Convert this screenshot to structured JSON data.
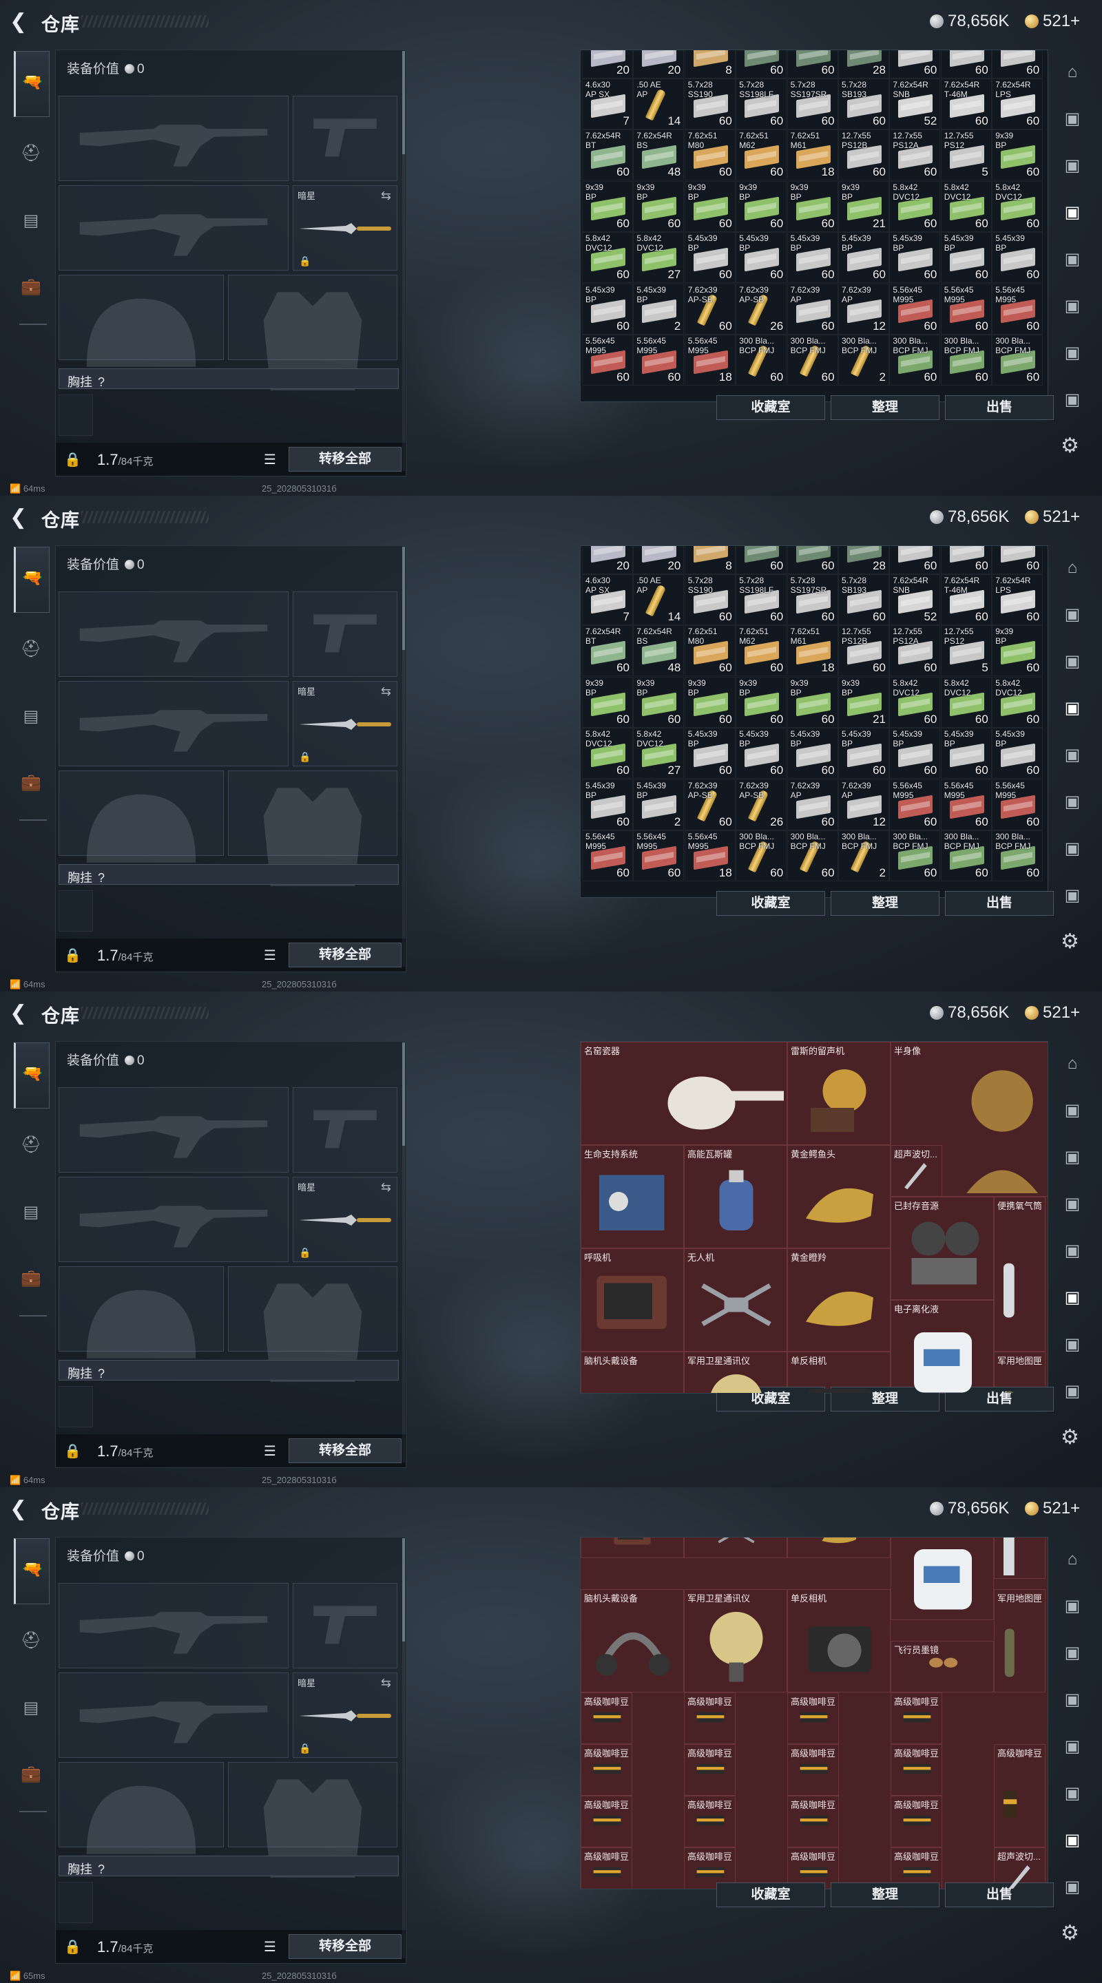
{
  "header": {
    "title": "仓库",
    "silver": "78,656K",
    "gold": "521+"
  },
  "equipment": {
    "value_label": "装备价值",
    "value": "0",
    "secondary_label": "暗星",
    "chest_label": "胸挂",
    "chest_help": "?",
    "weight": "1.7",
    "weight_max": "/84千克",
    "transfer_label": "转移全部"
  },
  "status": {
    "ping_1": "64ms",
    "ping_4": "65ms",
    "build": "25_20280531031б"
  },
  "actions": {
    "collection": "收藏室",
    "sort": "整理",
    "sell": "出售"
  },
  "icons": [
    "back-arrow-icon",
    "pistol-icon",
    "helmet-icon",
    "armor-icon",
    "backpack-icon",
    "lock-icon",
    "list-icon",
    "settings-icon",
    "silver-coin-icon",
    "gold-coin-icon"
  ],
  "colors": {
    "stash_bg": "#121820",
    "valuables_bg": "#4a2125",
    "gold_coin": "#d9a441",
    "silver_coin": "#b8bec4"
  },
  "ammo_view_1": {
    "rows": [
      [
        {
          "n": "",
          "q": "20",
          "c": "#b8b9c6"
        },
        {
          "n": "",
          "q": "20",
          "c": "#b8b9c6"
        },
        {
          "n": "",
          "q": "8",
          "c": "#cfa86a"
        },
        {
          "n": "",
          "q": "60",
          "c": "#6e8a73"
        },
        {
          "n": "",
          "q": "60",
          "c": "#6e8a73"
        },
        {
          "n": "",
          "q": "28",
          "c": "#6e8a73"
        },
        {
          "n": "",
          "q": "60",
          "c": "#c8c8c8"
        },
        {
          "n": "",
          "q": "60",
          "c": "#c8c8c8"
        },
        {
          "n": "",
          "q": "60",
          "c": "#c8c8c8"
        }
      ],
      [
        {
          "n": "4.6x30\nAP SX",
          "q": "7",
          "c": "#cfcfcf"
        },
        {
          "n": ".50 AE\nAP",
          "q": "14",
          "c": "shell"
        },
        {
          "n": "5.7x28\nSS190",
          "q": "60",
          "c": "#c8c8c8"
        },
        {
          "n": "5.7x28\nSS198LF",
          "q": "60",
          "c": "#c8c8c8"
        },
        {
          "n": "5.7x28\nSS197SR",
          "q": "60",
          "c": "#c8c8c8"
        },
        {
          "n": "5.7x28\nSB193",
          "q": "60",
          "c": "#c8c8c8"
        },
        {
          "n": "7.62x54R\nSNB",
          "q": "52",
          "c": "#d6d6d6"
        },
        {
          "n": "7.62x54R\nT-46M",
          "q": "60",
          "c": "#d6d6d6"
        },
        {
          "n": "7.62x54R\nLPS",
          "q": "60",
          "c": "#d6d6d6"
        }
      ],
      [
        {
          "n": "7.62x54R\nBT",
          "q": "60",
          "c": "#8fb58e"
        },
        {
          "n": "7.62x54R\nBS",
          "q": "48",
          "c": "#8fb58e"
        },
        {
          "n": "7.62x51\nM80",
          "q": "60",
          "c": "#d9a65a"
        },
        {
          "n": "7.62x51\nM62",
          "q": "60",
          "c": "#d9a65a"
        },
        {
          "n": "7.62x51\nM61",
          "q": "18",
          "c": "#d9a65a"
        },
        {
          "n": "12.7x55\nPS12B",
          "q": "60",
          "c": "#c8c8c8"
        },
        {
          "n": "12.7x55\nPS12A",
          "q": "60",
          "c": "#c8c8c8"
        },
        {
          "n": "12.7x55\nPS12",
          "q": "5",
          "c": "#c8c8c8"
        },
        {
          "n": "9x39\nBP",
          "q": "60",
          "c": "#8ec16a"
        }
      ],
      [
        {
          "n": "9x39\nBP",
          "q": "60",
          "c": "#8ec16a"
        },
        {
          "n": "9x39\nBP",
          "q": "60",
          "c": "#8ec16a"
        },
        {
          "n": "9x39\nBP",
          "q": "60",
          "c": "#8ec16a"
        },
        {
          "n": "9x39\nBP",
          "q": "60",
          "c": "#8ec16a"
        },
        {
          "n": "9x39\nBP",
          "q": "60",
          "c": "#8ec16a"
        },
        {
          "n": "9x39\nBP",
          "q": "21",
          "c": "#8ec16a"
        },
        {
          "n": "5.8x42\nDVC12",
          "q": "60",
          "c": "#8ec16a"
        },
        {
          "n": "5.8x42\nDVC12",
          "q": "60",
          "c": "#8ec16a"
        },
        {
          "n": "5.8x42\nDVC12",
          "q": "60",
          "c": "#8ec16a"
        }
      ],
      [
        {
          "n": "5.8x42\nDVC12",
          "q": "60",
          "c": "#8ec16a"
        },
        {
          "n": "5.8x42\nDVC12",
          "q": "27",
          "c": "#8ec16a"
        },
        {
          "n": "5.45x39\nBP",
          "q": "60",
          "c": "#c8c8c8"
        },
        {
          "n": "5.45x39\nBP",
          "q": "60",
          "c": "#c8c8c8"
        },
        {
          "n": "5.45x39\nBP",
          "q": "60",
          "c": "#c8c8c8"
        },
        {
          "n": "5.45x39\nBP",
          "q": "60",
          "c": "#c8c8c8"
        },
        {
          "n": "5.45x39\nBP",
          "q": "60",
          "c": "#c8c8c8"
        },
        {
          "n": "5.45x39\nBP",
          "q": "60",
          "c": "#c8c8c8"
        },
        {
          "n": "5.45x39\nBP",
          "q": "60",
          "c": "#c8c8c8"
        }
      ],
      [
        {
          "n": "5.45x39\nBP",
          "q": "60",
          "c": "#c8c8c8"
        },
        {
          "n": "5.45x39\nBP",
          "q": "2",
          "c": "#c8c8c8"
        },
        {
          "n": "7.62x39\nAP-SB",
          "q": "60",
          "c": "shell"
        },
        {
          "n": "7.62x39\nAP-SB",
          "q": "26",
          "c": "shell"
        },
        {
          "n": "7.62x39\nAP",
          "q": "60",
          "c": "#c8c8c8"
        },
        {
          "n": "7.62x39\nAP",
          "q": "12",
          "c": "#c8c8c8"
        },
        {
          "n": "5.56x45\nM995",
          "q": "60",
          "c": "#c05b55"
        },
        {
          "n": "5.56x45\nM995",
          "q": "60",
          "c": "#c05b55"
        },
        {
          "n": "5.56x45\nM995",
          "q": "60",
          "c": "#c05b55"
        }
      ],
      [
        {
          "n": "5.56x45\nM995",
          "q": "60",
          "c": "#c05b55"
        },
        {
          "n": "5.56x45\nM995",
          "q": "60",
          "c": "#c05b55"
        },
        {
          "n": "5.56x45\nM995",
          "q": "18",
          "c": "#c05b55"
        },
        {
          "n": "300 Bla...\nBCP FMJ",
          "q": "60",
          "c": "shell"
        },
        {
          "n": "300 Bla...\nBCP FMJ",
          "q": "60",
          "c": "shell"
        },
        {
          "n": "300 Bla...\nBCP FMJ",
          "q": "2",
          "c": "shell"
        },
        {
          "n": "300 Bla...\nBCP FMJ",
          "q": "60",
          "c": "#7ca86e"
        },
        {
          "n": "300 Bla...\nBCP FMJ",
          "q": "60",
          "c": "#7ca86e"
        },
        {
          "n": "300 Bla...\nBCP FMJ",
          "q": "60",
          "c": "#7ca86e"
        }
      ]
    ]
  },
  "ammo_view_2": {
    "rows": [
      [
        {
          "n": "",
          "q": "20",
          "c": "#b8b9c6"
        },
        {
          "n": "",
          "q": "20",
          "c": "#b8b9c6"
        },
        {
          "n": "",
          "q": "8",
          "c": "#cfa86a"
        },
        {
          "n": "",
          "q": "60",
          "c": "#6e8a73"
        },
        {
          "n": "",
          "q": "60",
          "c": "#6e8a73"
        },
        {
          "n": "",
          "q": "28",
          "c": "#6e8a73"
        },
        {
          "n": "",
          "q": "60",
          "c": "#c8c8c8"
        },
        {
          "n": "",
          "q": "60",
          "c": "#c8c8c8"
        },
        {
          "n": "",
          "q": "60",
          "c": "#c8c8c8"
        }
      ],
      [
        {
          "n": "4.6x30\nAP SX",
          "q": "7",
          "c": "#cfcfcf"
        },
        {
          "n": ".50 AE\nAP",
          "q": "14",
          "c": "shell"
        },
        {
          "n": "5.7x28\nSS190",
          "q": "60",
          "c": "#c8c8c8"
        },
        {
          "n": "5.7x28\nSS198LF",
          "q": "60",
          "c": "#c8c8c8"
        },
        {
          "n": "5.7x28\nSS197SR",
          "q": "60",
          "c": "#c8c8c8"
        },
        {
          "n": "5.7x28\nSB193",
          "q": "60",
          "c": "#c8c8c8"
        },
        {
          "n": "7.62x54R\nSNB",
          "q": "52",
          "c": "#d6d6d6"
        },
        {
          "n": "7.62x54R\nT-46M",
          "q": "60",
          "c": "#d6d6d6"
        },
        {
          "n": "7.62x54R\nLPS",
          "q": "60",
          "c": "#d6d6d6"
        }
      ],
      [
        {
          "n": "7.62x54R\nBT",
          "q": "60",
          "c": "#8fb58e"
        },
        {
          "n": "7.62x54R\nBS",
          "q": "48",
          "c": "#8fb58e"
        },
        {
          "n": "7.62x51\nM80",
          "q": "60",
          "c": "#d9a65a"
        },
        {
          "n": "7.62x51\nM62",
          "q": "60",
          "c": "#d9a65a"
        },
        {
          "n": "7.62x51\nM61",
          "q": "18",
          "c": "#d9a65a"
        },
        {
          "n": "12.7x55\nPS12B",
          "q": "60",
          "c": "#c8c8c8"
        },
        {
          "n": "12.7x55\nPS12A",
          "q": "60",
          "c": "#c8c8c8"
        },
        {
          "n": "12.7x55\nPS12",
          "q": "5",
          "c": "#c8c8c8"
        },
        {
          "n": "9x39\nBP",
          "q": "60",
          "c": "#8ec16a"
        }
      ],
      [
        {
          "n": "9x39\nBP",
          "q": "60",
          "c": "#8ec16a"
        },
        {
          "n": "9x39\nBP",
          "q": "60",
          "c": "#8ec16a"
        },
        {
          "n": "9x39\nBP",
          "q": "60",
          "c": "#8ec16a"
        },
        {
          "n": "9x39\nBP",
          "q": "60",
          "c": "#8ec16a"
        },
        {
          "n": "9x39\nBP",
          "q": "60",
          "c": "#8ec16a"
        },
        {
          "n": "9x39\nBP",
          "q": "21",
          "c": "#8ec16a"
        },
        {
          "n": "5.8x42\nDVC12",
          "q": "60",
          "c": "#8ec16a"
        },
        {
          "n": "5.8x42\nDVC12",
          "q": "60",
          "c": "#8ec16a"
        },
        {
          "n": "5.8x42\nDVC12",
          "q": "60",
          "c": "#8ec16a"
        }
      ],
      [
        {
          "n": "5.8x42\nDVC12",
          "q": "60",
          "c": "#8ec16a"
        },
        {
          "n": "5.8x42\nDVC12",
          "q": "27",
          "c": "#8ec16a"
        },
        {
          "n": "5.45x39\nBP",
          "q": "60",
          "c": "#c8c8c8"
        },
        {
          "n": "5.45x39\nBP",
          "q": "60",
          "c": "#c8c8c8"
        },
        {
          "n": "5.45x39\nBP",
          "q": "60",
          "c": "#c8c8c8"
        },
        {
          "n": "5.45x39\nBP",
          "q": "60",
          "c": "#c8c8c8"
        },
        {
          "n": "5.45x39\nBP",
          "q": "60",
          "c": "#c8c8c8"
        },
        {
          "n": "5.45x39\nBP",
          "q": "60",
          "c": "#c8c8c8"
        },
        {
          "n": "5.45x39\nBP",
          "q": "60",
          "c": "#c8c8c8"
        }
      ],
      [
        {
          "n": "5.45x39\nBP",
          "q": "60",
          "c": "#c8c8c8"
        },
        {
          "n": "5.45x39\nBP",
          "q": "2",
          "c": "#c8c8c8"
        },
        {
          "n": "7.62x39\nAP-SB",
          "q": "60",
          "c": "shell"
        },
        {
          "n": "7.62x39\nAP-SB",
          "q": "26",
          "c": "shell"
        },
        {
          "n": "7.62x39\nAP",
          "q": "60",
          "c": "#c8c8c8"
        },
        {
          "n": "7.62x39\nAP",
          "q": "12",
          "c": "#c8c8c8"
        },
        {
          "n": "5.56x45\nM995",
          "q": "60",
          "c": "#c05b55"
        },
        {
          "n": "5.56x45\nM995",
          "q": "60",
          "c": "#c05b55"
        },
        {
          "n": "5.56x45\nM995",
          "q": "60",
          "c": "#c05b55"
        }
      ],
      [
        {
          "n": "5.56x45\nM995",
          "q": "60",
          "c": "#c05b55"
        },
        {
          "n": "5.56x45\nM995",
          "q": "60",
          "c": "#c05b55"
        },
        {
          "n": "5.56x45\nM995",
          "q": "18",
          "c": "#c05b55"
        },
        {
          "n": "300 Bla...\nBCP FMJ",
          "q": "60",
          "c": "shell"
        },
        {
          "n": "300 Bla...\nBCP FMJ",
          "q": "60",
          "c": "shell"
        },
        {
          "n": "300 Bla...\nBCP FMJ",
          "q": "2",
          "c": "shell"
        },
        {
          "n": "300 Bla...\nBCP FMJ",
          "q": "60",
          "c": "#7ca86e"
        },
        {
          "n": "300 Bla...\nBCP FMJ",
          "q": "60",
          "c": "#7ca86e"
        },
        {
          "n": "300 Bla...\nBCP FMJ",
          "q": "60",
          "c": "#7ca86e"
        }
      ]
    ]
  },
  "valuables_view_3": {
    "items": [
      {
        "n": "名窑瓷器",
        "shape": "vase",
        "col": 0,
        "row": 0,
        "w": 2,
        "h": 1
      },
      {
        "n": "雷斯的留声机",
        "shape": "gramophone",
        "col": 2,
        "row": 0,
        "w": 1,
        "h": 1
      },
      {
        "n": "半身像",
        "shape": "bust",
        "col": 3,
        "row": 0,
        "w": 2,
        "h": 1.5
      },
      {
        "n": "生命支持系统",
        "shape": "machine",
        "col": 0,
        "row": 1,
        "w": 1,
        "h": 1
      },
      {
        "n": "高能瓦斯罐",
        "shape": "canister",
        "col": 1,
        "row": 1,
        "w": 1,
        "h": 1
      },
      {
        "n": "黄金鳄鱼头",
        "shape": "goldhead",
        "col": 2,
        "row": 1,
        "w": 1,
        "h": 1
      },
      {
        "n": "超声波切...",
        "shape": "knife",
        "col": 3,
        "row": 1,
        "w": 0.5,
        "h": 0.5
      },
      {
        "n": "已封存音源",
        "shape": "projector",
        "col": 3,
        "row": 1.5,
        "w": 1,
        "h": 1
      },
      {
        "n": "便携氧气筒",
        "shape": "bottle",
        "col": 4,
        "row": 1.5,
        "w": 0.5,
        "h": 1.5
      },
      {
        "n": "呼吸机",
        "shape": "monitor",
        "col": 0,
        "row": 2,
        "w": 1,
        "h": 1
      },
      {
        "n": "无人机",
        "shape": "drone",
        "col": 1,
        "row": 2,
        "w": 1,
        "h": 1
      },
      {
        "n": "黄金瞪羚",
        "shape": "goldhead",
        "col": 2,
        "row": 2,
        "w": 1,
        "h": 1
      },
      {
        "n": "电子离化液",
        "shape": "jug",
        "col": 3,
        "row": 2.5,
        "w": 1,
        "h": 1
      },
      {
        "n": "脑机头戴设备",
        "shape": "headset",
        "col": 0,
        "row": 3,
        "w": 1,
        "h": 1
      },
      {
        "n": "军用卫星通讯仪",
        "shape": "dish",
        "col": 1,
        "row": 3,
        "w": 1,
        "h": 1
      },
      {
        "n": "单反相机",
        "shape": "camera",
        "col": 2,
        "row": 3,
        "w": 1,
        "h": 1
      },
      {
        "n": "军用地图匣",
        "shape": "tube",
        "col": 4,
        "row": 3,
        "w": 0.5,
        "h": 1
      }
    ]
  },
  "valuables_view_4": {
    "items": [
      {
        "n": "",
        "shape": "monitor",
        "col": 0,
        "row": -0.4,
        "w": 1,
        "h": 0.6
      },
      {
        "n": "",
        "shape": "drone",
        "col": 1,
        "row": -0.4,
        "w": 1,
        "h": 0.6
      },
      {
        "n": "",
        "shape": "goldhead",
        "col": 2,
        "row": -0.4,
        "w": 1,
        "h": 0.6
      },
      {
        "n": "电子离化液",
        "shape": "jug",
        "col": 3,
        "row": -0.2,
        "w": 1,
        "h": 1
      },
      {
        "n": "",
        "shape": "bottle",
        "col": 4,
        "row": -0.4,
        "w": 0.5,
        "h": 0.8
      },
      {
        "n": "脑机头戴设备",
        "shape": "headset",
        "col": 0,
        "row": 0.5,
        "w": 1,
        "h": 1
      },
      {
        "n": "军用卫星通讯仪",
        "shape": "dish",
        "col": 1,
        "row": 0.5,
        "w": 1,
        "h": 1
      },
      {
        "n": "单反相机",
        "shape": "camera",
        "col": 2,
        "row": 0.5,
        "w": 1,
        "h": 1
      },
      {
        "n": "飞行员墨镜",
        "shape": "glasses",
        "col": 3,
        "row": 1,
        "w": 1,
        "h": 0.5
      },
      {
        "n": "军用地图匣",
        "shape": "tube",
        "col": 4,
        "row": 0.5,
        "w": 0.5,
        "h": 1
      },
      {
        "n": "高级咖啡豆",
        "shape": "coffee",
        "col": 0,
        "row": 1.5,
        "w": 0.5,
        "h": 0.5
      },
      {
        "n": "高级咖啡豆",
        "shape": "coffee",
        "col": 1,
        "row": 1.5,
        "w": 0.5,
        "h": 0.5
      },
      {
        "n": "高级咖啡豆",
        "shape": "coffee",
        "col": 2,
        "row": 1.5,
        "w": 0.5,
        "h": 0.5
      },
      {
        "n": "高级咖啡豆",
        "shape": "coffee",
        "col": 3,
        "row": 1.5,
        "w": 0.5,
        "h": 0.5
      },
      {
        "n": "高级咖啡豆",
        "shape": "coffee",
        "col": 0,
        "row": 2,
        "w": 0.5,
        "h": 0.5
      },
      {
        "n": "高级咖啡豆",
        "shape": "coffee",
        "col": 1,
        "row": 2,
        "w": 0.5,
        "h": 0.5
      },
      {
        "n": "高级咖啡豆",
        "shape": "coffee",
        "col": 2,
        "row": 2,
        "w": 0.5,
        "h": 0.5
      },
      {
        "n": "高级咖啡豆",
        "shape": "coffee",
        "col": 3,
        "row": 2,
        "w": 0.5,
        "h": 0.5
      },
      {
        "n": "高级咖啡豆",
        "shape": "coffeebag",
        "col": 4,
        "row": 2,
        "w": 0.5,
        "h": 1
      },
      {
        "n": "高级咖啡豆",
        "shape": "coffee",
        "col": 0,
        "row": 2.5,
        "w": 0.5,
        "h": 0.5
      },
      {
        "n": "高级咖啡豆",
        "shape": "coffee",
        "col": 1,
        "row": 2.5,
        "w": 0.5,
        "h": 0.5
      },
      {
        "n": "高级咖啡豆",
        "shape": "coffee",
        "col": 2,
        "row": 2.5,
        "w": 0.5,
        "h": 0.5
      },
      {
        "n": "高级咖啡豆",
        "shape": "coffee",
        "col": 3,
        "row": 2.5,
        "w": 0.5,
        "h": 0.5
      },
      {
        "n": "高级咖啡豆",
        "shape": "coffee",
        "col": 0,
        "row": 3,
        "w": 0.5,
        "h": 0.5
      },
      {
        "n": "高级咖啡豆",
        "shape": "coffee",
        "col": 1,
        "row": 3,
        "w": 0.5,
        "h": 0.5
      },
      {
        "n": "高级咖啡豆",
        "shape": "coffee",
        "col": 2,
        "row": 3,
        "w": 0.5,
        "h": 0.5
      },
      {
        "n": "高级咖啡豆",
        "shape": "coffee",
        "col": 3,
        "row": 3,
        "w": 0.5,
        "h": 0.5
      },
      {
        "n": "超声波切...",
        "shape": "knife",
        "col": 4,
        "row": 3,
        "w": 0.5,
        "h": 0.5
      }
    ]
  }
}
